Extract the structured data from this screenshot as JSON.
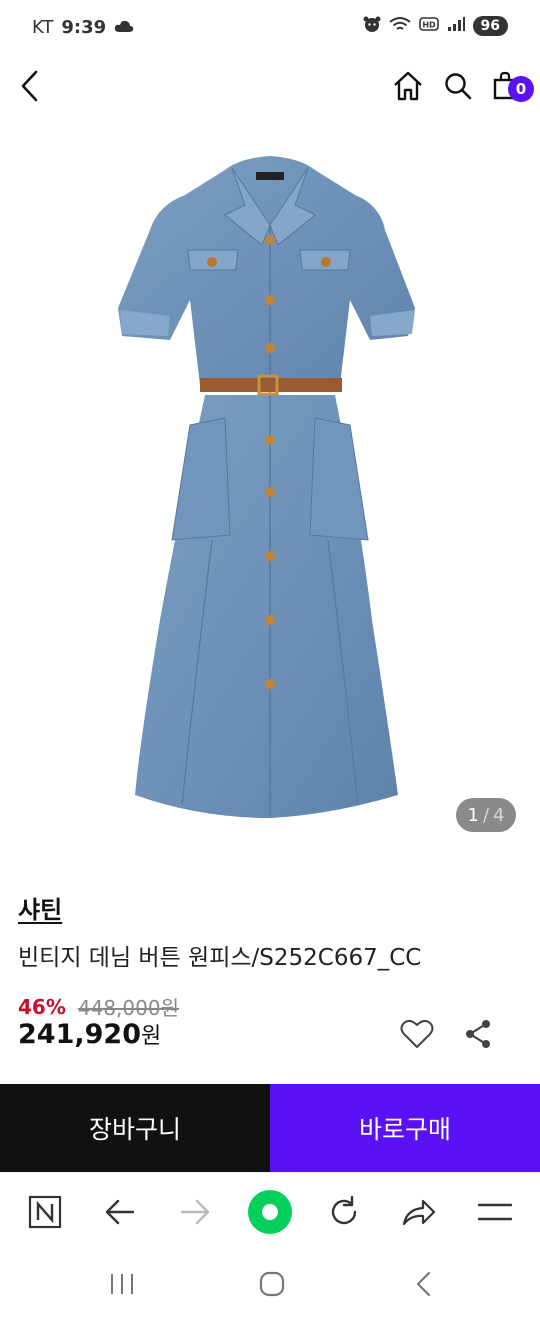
{
  "status_bar": {
    "carrier": "KT",
    "time": "9:39",
    "battery": "96"
  },
  "header": {
    "cart_count": "0"
  },
  "product": {
    "brand": "샤틴",
    "name": "빈티지 데님 버튼 원피스/S252C667_CC",
    "discount": "46%",
    "original_price": "448,000원",
    "price": "241,920",
    "price_unit": "원",
    "image_index": "1",
    "image_separator": "/",
    "image_total": "4"
  },
  "actions": {
    "cart_label": "장바구니",
    "buy_label": "바로구매"
  },
  "colors": {
    "accent": "#5a11f5",
    "discount": "#c8102e",
    "denim": "#6f93b8"
  },
  "icons": [
    "back-icon",
    "home-icon",
    "search-icon",
    "cart-icon",
    "heart-icon",
    "share-icon",
    "naver-icon",
    "arrow-left-icon",
    "arrow-right-icon",
    "green-dot-icon",
    "refresh-icon",
    "forward-share-icon",
    "menu-icon",
    "recent-apps-icon",
    "home-circle-icon",
    "nav-back-icon"
  ]
}
